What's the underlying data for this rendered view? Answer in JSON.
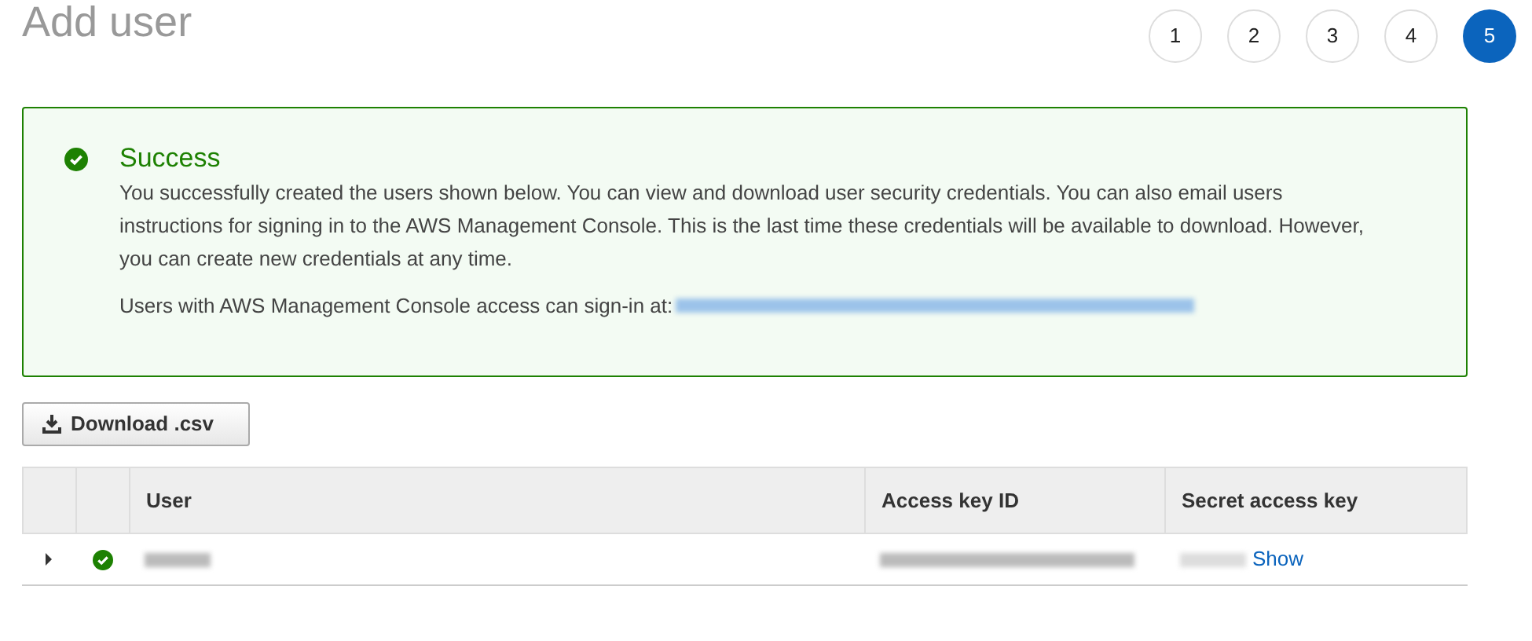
{
  "page": {
    "title": "Add user"
  },
  "steps": [
    {
      "label": "1",
      "selected": false
    },
    {
      "label": "2",
      "selected": false
    },
    {
      "label": "3",
      "selected": false
    },
    {
      "label": "4",
      "selected": false
    },
    {
      "label": "5",
      "selected": true
    }
  ],
  "alert": {
    "kind": "success",
    "title": "Success",
    "message": "You successfully created the users shown below. You can view and download user security credentials. You can also email users instructions for signing in to the AWS Management Console. This is the last time these credentials will be available to download. However, you can create new credentials at any time.",
    "signin_text": "Users with AWS Management Console access can sign-in at:"
  },
  "download_button": {
    "label": "Download .csv"
  },
  "table": {
    "columns": [
      "User",
      "Access key ID",
      "Secret access key"
    ],
    "rows": [
      {
        "expanded": false,
        "succeeded": true,
        "secret_action": "Show"
      }
    ]
  }
}
